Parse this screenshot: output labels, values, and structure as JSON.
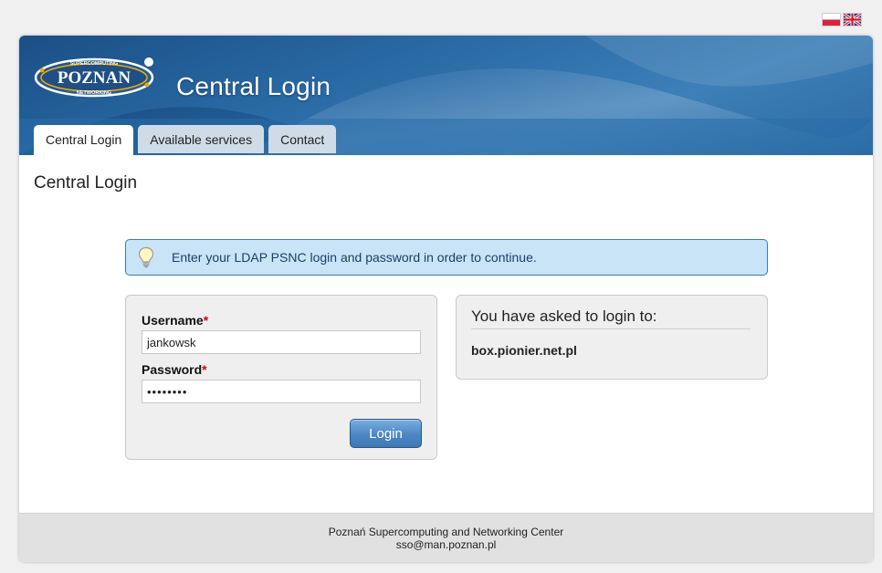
{
  "languages": [
    {
      "code": "pl",
      "icon": "flag-pl-icon"
    },
    {
      "code": "en",
      "icon": "flag-uk-icon"
    }
  ],
  "header": {
    "logo_text": "POZNAN",
    "logo_top_text": "SUPERCOMPUTING",
    "logo_bottom_text": "NETWORKING",
    "title": "Central Login"
  },
  "tabs": [
    {
      "label": "Central Login",
      "active": true
    },
    {
      "label": "Available services",
      "active": false
    },
    {
      "label": "Contact",
      "active": false
    }
  ],
  "page": {
    "title": "Central Login"
  },
  "info": {
    "icon": "lightbulb-icon",
    "message": "Enter your LDAP PSNC login and password in order to continue."
  },
  "login_form": {
    "username_label": "Username",
    "username_value": "jankowsk",
    "password_label": "Password",
    "password_value": "••••••••",
    "required_marker": "*",
    "submit_label": "Login"
  },
  "target": {
    "heading": "You have asked to login to:",
    "host": "box.pionier.net.pl"
  },
  "footer": {
    "org": "Poznań Supercomputing and Networking Center",
    "email": "sso@man.poznan.pl"
  },
  "colors": {
    "header_blue": "#2a6ba6",
    "tab_inactive": "#cfdce8",
    "info_bg": "#c9e4f7",
    "info_border": "#3b79b8",
    "button_blue": "#4c87c4",
    "required_red": "#d0021b"
  }
}
